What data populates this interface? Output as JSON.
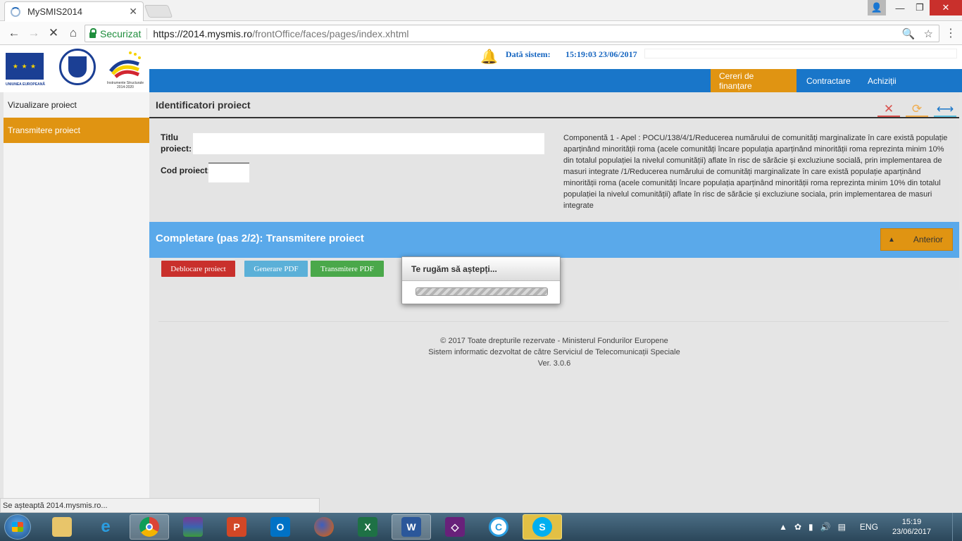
{
  "browser": {
    "tab_title": "MySMIS2014",
    "tab_close": "✕",
    "secure_label": "Securizat",
    "url_host": "https://2014.mysmis.ro",
    "url_path": "/frontOffice/faces/pages/index.xhtml",
    "status_text": "Se așteaptă 2014.mysmis.ro..."
  },
  "logos": {
    "eu_caption": "UNIUNEA EUROPEANĂ",
    "is_caption": "Instrumente Structurale 2014-2020"
  },
  "header": {
    "date_label": "Dată sistem:",
    "date_value": "15:19:03 23/06/2017"
  },
  "nav": {
    "items": [
      {
        "label": "Cereri de finanțare",
        "active": true
      },
      {
        "label": "Contractare",
        "active": false
      },
      {
        "label": "Achiziții",
        "active": false
      }
    ]
  },
  "sidebar": {
    "items": [
      {
        "label": "Vizualizare proiect",
        "active": false
      },
      {
        "label": "Transmitere proiect",
        "active": true
      }
    ]
  },
  "panel": {
    "title": "Identificatori proiect",
    "title_label_1": "Titlu",
    "title_label_2": "proiect:",
    "code_label": "Cod proiect:",
    "description": "Componentă 1 - Apel : POCU/138/4/1/Reducerea numărului de comunități marginalizate în care există populație aparținând minorității roma (acele comunități încare populația aparținând minorității roma reprezinta minim 10% din totalul populației la nivelul comunității) aflate în risc de sărăcie și excluziune socială, prin implementarea de masuri integrate /1/Reducerea numărului de comunități marginalizate în care există populație aparținând minorității roma (acele comunități încare populația aparținând minorității roma reprezinta minim 10% din totalul populației la nivelul comunității) aflate în risc de sărăcie și excluziune sociala, prin implementarea de masuri integrate"
  },
  "step": {
    "title": "Completare (pas 2/2): Transmitere proiect",
    "prev_label": "Anterior"
  },
  "actions": {
    "unlock_label": "Deblocare proiect",
    "generate_label": "Generare PDF",
    "send_label": "Transmitere PDF"
  },
  "modal": {
    "title": "Te rugăm să aștepți..."
  },
  "footer": {
    "line1": "© 2017 Toate drepturile rezervate - Ministerul Fondurilor Europene",
    "line2": "Sistem informatic dezvoltat de către Serviciul de Telecomunicații Speciale",
    "line3": "Ver. 3.0.6"
  },
  "taskbar": {
    "lang": "ENG",
    "time": "15:19",
    "date": "23/06/2017"
  },
  "colors": {
    "nav_blue": "#1976c9",
    "accent_orange": "#e09412",
    "step_blue": "#5aa9ea",
    "btn_red": "#d9534f",
    "btn_lightblue": "#5bc0de",
    "btn_green": "#4cae4c"
  }
}
